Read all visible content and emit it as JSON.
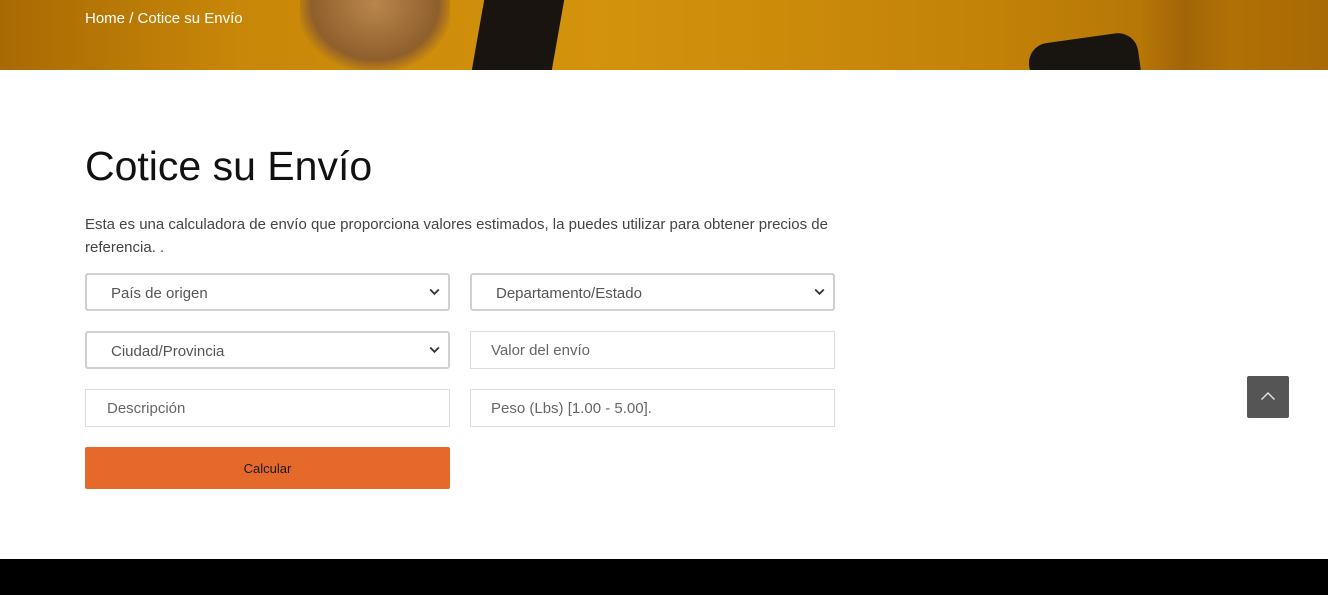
{
  "breadcrumb": {
    "home": "Home",
    "separator": "/",
    "current": "Cotice su Envío"
  },
  "page": {
    "title": "Cotice su Envío",
    "description": "Esta es una calculadora de envío que proporciona valores estimados, la puedes utilizar para obtener precios de referencia. ."
  },
  "form": {
    "origin_country": {
      "selected": "País de origen"
    },
    "department_state": {
      "selected": "Departamento/Estado"
    },
    "city_province": {
      "selected": "Ciudad/Provincia"
    },
    "shipment_value": {
      "placeholder": "Valor del envío",
      "value": ""
    },
    "description": {
      "placeholder": "Descripción",
      "value": ""
    },
    "weight": {
      "placeholder": "Peso (Lbs) [1.00 - 5.00].",
      "value": ""
    },
    "submit_label": "Calcular"
  },
  "icons": {
    "select_chevron": "chevron-down-icon",
    "scroll_top": "chevron-up-icon"
  },
  "colors": {
    "hero": "#c88708",
    "button": "#e5692a",
    "scroll_top_bg": "#555555",
    "footer": "#000000"
  }
}
